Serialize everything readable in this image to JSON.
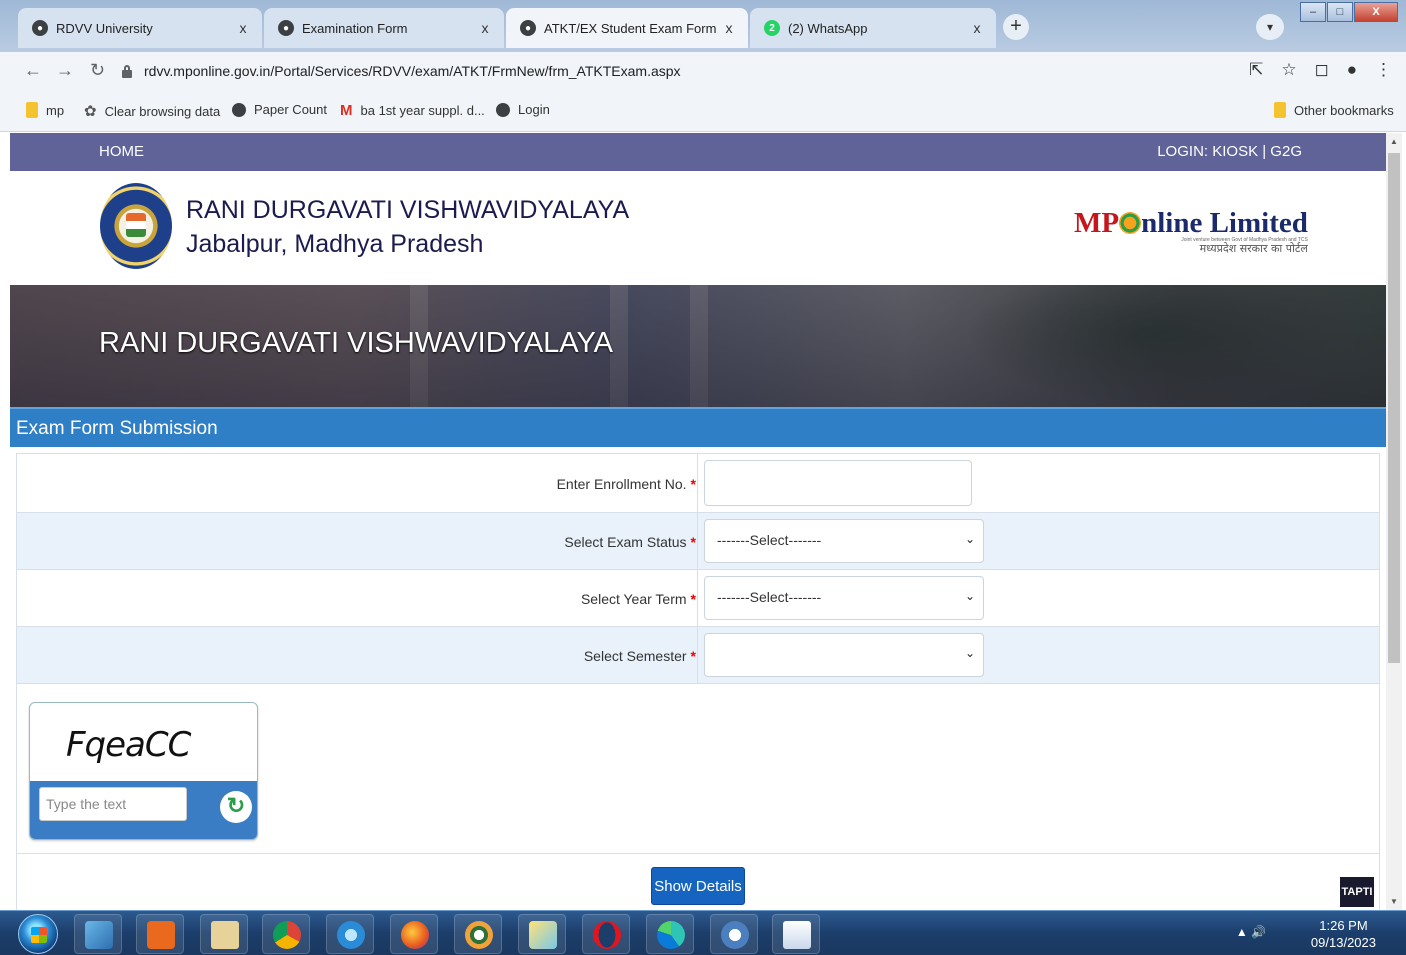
{
  "browser": {
    "tabs": [
      {
        "label": "RDVV University",
        "icon": "globe-icon",
        "active": false
      },
      {
        "label": "Examination Form",
        "icon": "globe-icon",
        "active": false
      },
      {
        "label": "ATKT/EX Student Exam Form",
        "icon": "globe-icon",
        "active": true
      },
      {
        "label": "(2) WhatsApp",
        "icon": "whatsapp-icon",
        "active": false,
        "badge": "2"
      }
    ],
    "close_glyph": "x",
    "new_tab_glyph": "+",
    "url": "rdvv.mponline.gov.in/Portal/Services/RDVV/exam/ATKT/FrmNew/frm_ATKTExam.aspx",
    "bookmarks": [
      {
        "label": "mp",
        "icon": "folder-icon"
      },
      {
        "label": "Clear browsing data",
        "icon": "gear-icon"
      },
      {
        "label": "Paper Count",
        "icon": "globe-icon"
      },
      {
        "label": "ba 1st year suppl. d...",
        "icon": "gmail-icon"
      },
      {
        "label": "Login",
        "icon": "globe-icon"
      }
    ],
    "other_bookmarks": "Other bookmarks"
  },
  "site": {
    "nav": {
      "home": "HOME",
      "login": "LOGIN: KIOSK | G2G"
    },
    "university_name": "RANI DURGAVATI VISHWAVIDYALAYA",
    "university_location": "Jabalpur, Madhya Pradesh",
    "partner_logo": {
      "mp": "MP",
      "rest": "nline Limited",
      "hindi": "मध्यप्रदेश सरकार का पोर्टल",
      "tagline": "Joint venture between Govt of Madhya Pradesh and TCS"
    },
    "banner_title": "RANI DURGAVATI VISHWAVIDYALAYA"
  },
  "form": {
    "section_title": "Exam Form Submission",
    "required_mark": "*",
    "fields": [
      {
        "label": "Enter Enrollment No.",
        "type": "text",
        "value": ""
      },
      {
        "label": "Select Exam Status",
        "type": "select",
        "value": "-------Select-------"
      },
      {
        "label": "Select Year Term",
        "type": "select",
        "value": "-------Select-------"
      },
      {
        "label": "Select Semester",
        "type": "select",
        "value": ""
      }
    ],
    "captcha": {
      "code": "FqeaCC",
      "placeholder": "Type the text",
      "refresh_glyph": "↻"
    },
    "submit_label": "Show Details",
    "tapti_badge": "TAPTI"
  },
  "taskbar": {
    "apps": [
      "explorer",
      "outlook",
      "files",
      "chrome",
      "internet-explorer",
      "firefox",
      "media-player",
      "folder",
      "opera",
      "edge",
      "snipping-tool",
      "word"
    ],
    "time": "1:26 PM",
    "date": "09/13/2023"
  },
  "colors": {
    "nav_bar": "#5f6397",
    "section_header": "#2f7fc7",
    "button": "#1565c0",
    "row_alt": "#e9f2fb",
    "required": "#e00000"
  }
}
